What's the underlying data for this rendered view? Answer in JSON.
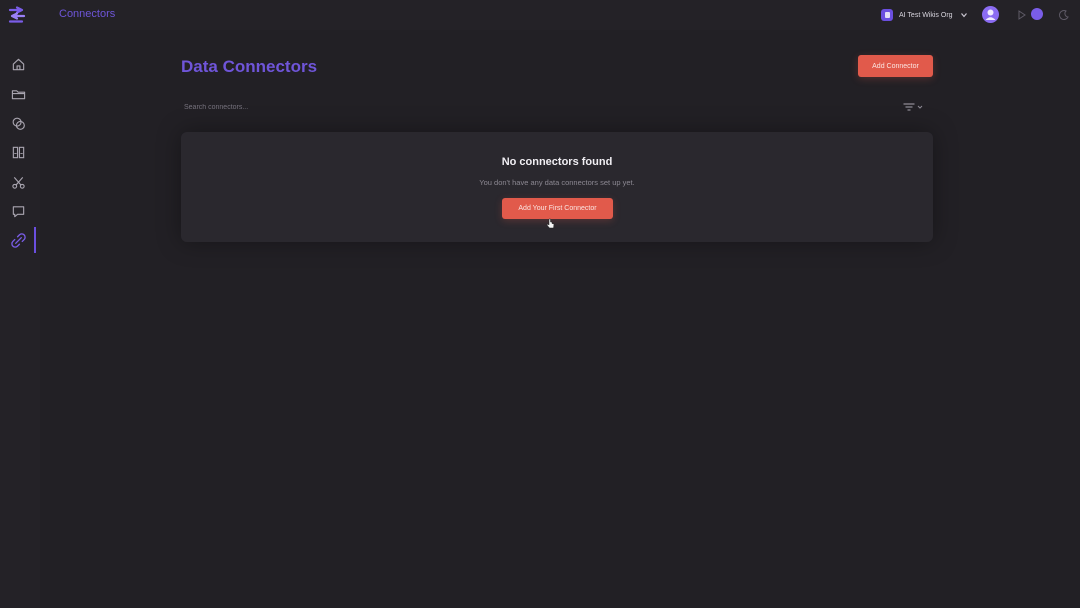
{
  "header": {
    "breadcrumb": "Connectors",
    "org_name": "AI Test Wikis Org"
  },
  "sidebar": {
    "items": [
      {
        "name": "home",
        "icon": "home-icon"
      },
      {
        "name": "files",
        "icon": "folder-icon"
      },
      {
        "name": "chats",
        "icon": "chat-icon"
      },
      {
        "name": "library",
        "icon": "book-icon"
      },
      {
        "name": "integrations",
        "icon": "scissors-icon"
      },
      {
        "name": "messages",
        "icon": "message-icon"
      },
      {
        "name": "connectors",
        "icon": "link-icon",
        "active": true
      }
    ]
  },
  "main": {
    "title": "Data Connectors",
    "add_button": "Add Connector",
    "search_placeholder": "Search connectors...",
    "empty": {
      "title": "No connectors found",
      "description": "You don't have any data connectors set up yet.",
      "button": "Add Your First Connector"
    }
  },
  "colors": {
    "accent": "#6f55d9",
    "cta": "#e15a4b",
    "background": "#222025"
  }
}
